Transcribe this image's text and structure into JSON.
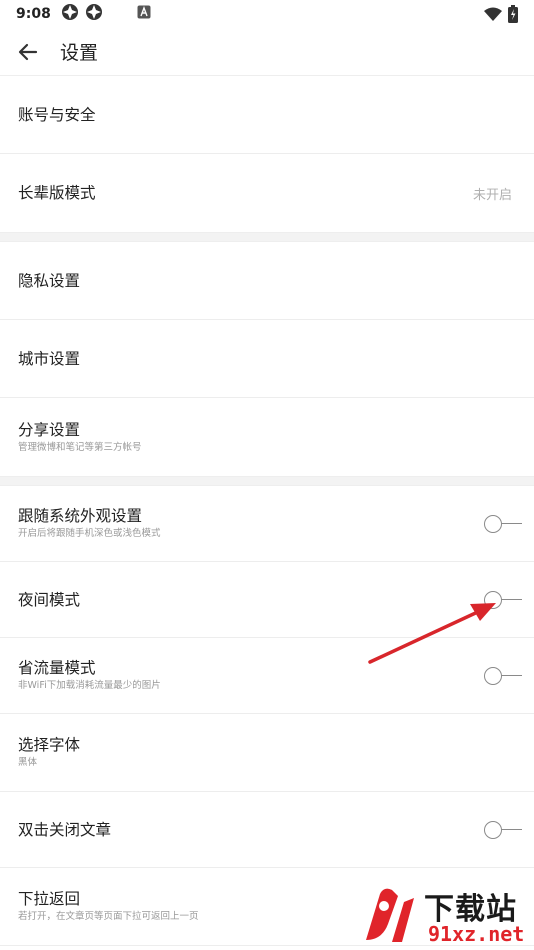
{
  "status_bar": {
    "time": "9:08",
    "left_icons": [
      "sync-icon",
      "sync-icon",
      "notification-a-icon"
    ],
    "right_icons": [
      "wifi-icon",
      "battery-charging-icon"
    ]
  },
  "header": {
    "title": "设置",
    "back_icon": "arrow-left-icon"
  },
  "group1": [
    {
      "title": "账号与安全"
    },
    {
      "title": "长辈版模式",
      "value": "未开启"
    }
  ],
  "group2": [
    {
      "title": "隐私设置"
    },
    {
      "title": "城市设置"
    },
    {
      "title": "分享设置",
      "subtitle": "管理微博和笔记等第三方帐号"
    }
  ],
  "group3": [
    {
      "title": "跟随系统外观设置",
      "subtitle": "开启后将跟随手机深色或浅色模式",
      "toggle": false
    },
    {
      "title": "夜间模式",
      "toggle": false
    },
    {
      "title": "省流量模式",
      "subtitle": "非WiFi下加载消耗流量最少的图片",
      "toggle": false
    },
    {
      "title": "选择字体",
      "subtitle": "黑体"
    },
    {
      "title": "双击关闭文章",
      "toggle": false
    },
    {
      "title": "下拉返回",
      "subtitle": "若打开，在文章页等页面下拉可返回上一页"
    }
  ],
  "annotation": {
    "color": "#d8262b",
    "icon": "red-arrow-annotation"
  },
  "watermark": {
    "title": "下载站",
    "url": "91xz.net",
    "logo": "91-logo-icon"
  },
  "colors": {
    "accent_red": "#e0242a",
    "toggle_off": "#8a8a8a"
  }
}
